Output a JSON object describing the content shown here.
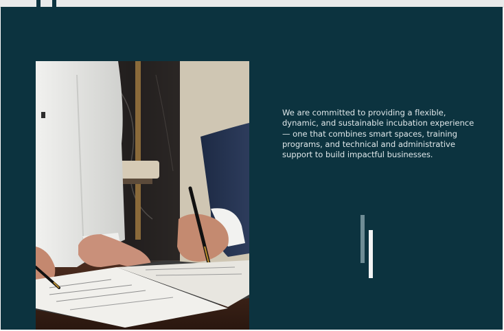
{
  "hero": {
    "mission_text": "We are committed to providing a flexible, dynamic, and sustainable incubation experience — one that combines smart spaces, training programs, and technical and administrative support to build impactful businesses."
  },
  "colors": {
    "panel_bg": "#0c333f",
    "text": "#dfe7e9",
    "accent_bar_dim": "#6f8d96",
    "accent_bar_light": "#f2f4f4"
  },
  "icons": {
    "decorative_bars": "vertical-bars-decoration"
  }
}
